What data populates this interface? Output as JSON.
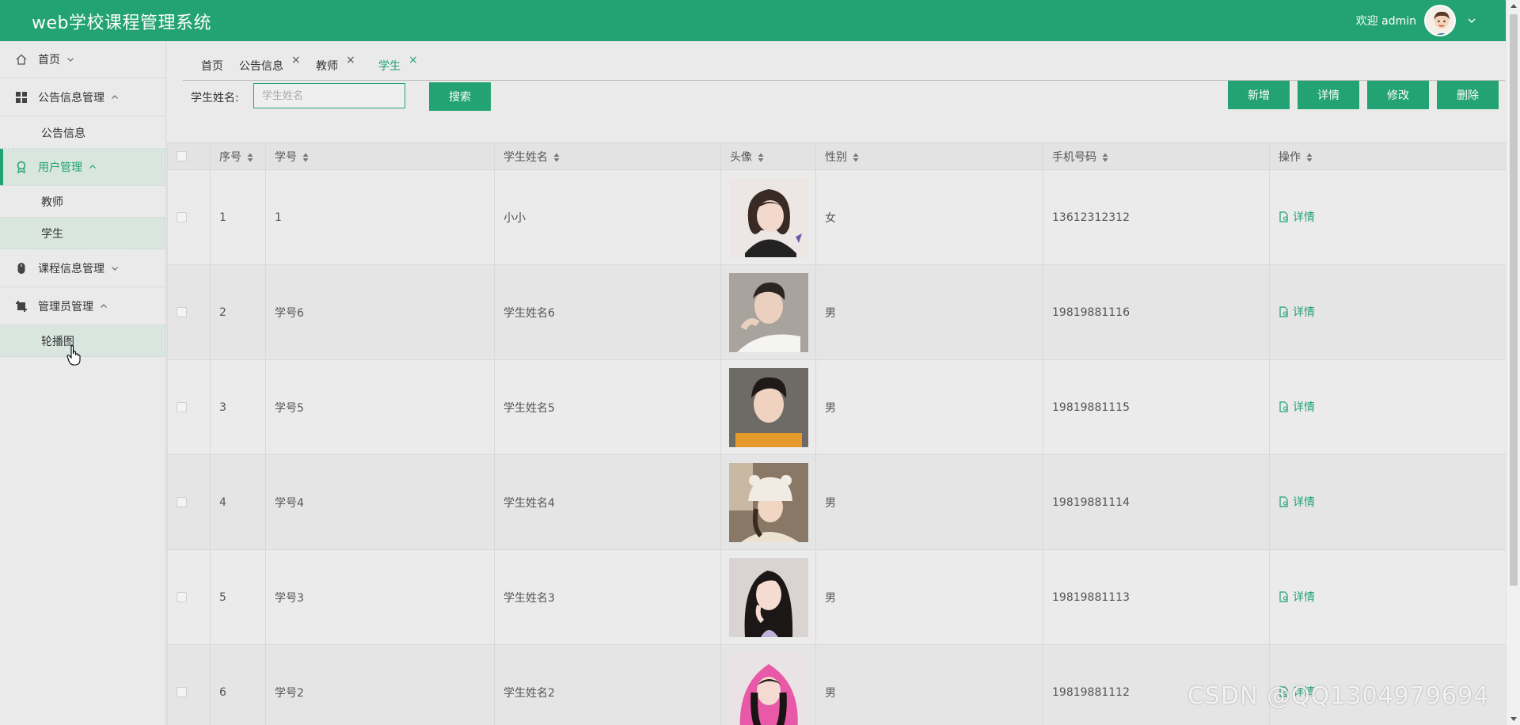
{
  "header": {
    "app_title": "web学校课程管理系统",
    "welcome": "欢迎 admin",
    "brand_color": "#23a274"
  },
  "sidebar": {
    "items": [
      {
        "label": "首页",
        "icon": "home-icon",
        "expanded": false
      },
      {
        "label": "公告信息管理",
        "icon": "grid-icon",
        "expanded": true,
        "children": [
          "公告信息"
        ]
      },
      {
        "label": "用户管理",
        "icon": "award-icon",
        "expanded": true,
        "active": true,
        "children": [
          "教师",
          "学生"
        ]
      },
      {
        "label": "课程信息管理",
        "icon": "mouse-icon",
        "expanded": false
      },
      {
        "label": "管理员管理",
        "icon": "crop-icon",
        "expanded": true,
        "children": [
          "轮播图"
        ]
      }
    ]
  },
  "tabs": [
    {
      "label": "首页",
      "closable": false
    },
    {
      "label": "公告信息",
      "closable": true
    },
    {
      "label": "教师",
      "closable": true
    },
    {
      "label": "学生",
      "closable": true,
      "current": true
    }
  ],
  "tab_close_glyph": "×",
  "search": {
    "label": "学生姓名:",
    "placeholder": "学生姓名",
    "value": "",
    "button": "搜索"
  },
  "actions": {
    "add": "新增",
    "detail": "详情",
    "edit": "修改",
    "delete": "删除"
  },
  "table": {
    "columns": [
      "序号",
      "学号",
      "学生姓名",
      "头像",
      "性别",
      "手机号码",
      "操作"
    ],
    "detail_label": "详情",
    "rows": [
      {
        "index": "1",
        "student_no": "1",
        "name": "小小",
        "photo": "avatar-girl-bob-hair",
        "gender": "女",
        "phone": "13612312312"
      },
      {
        "index": "2",
        "student_no": "学号6",
        "name": "学生姓名6",
        "photo": "avatar-boy-white-shirt",
        "gender": "男",
        "phone": "19819881116"
      },
      {
        "index": "3",
        "student_no": "学号5",
        "name": "学生姓名5",
        "photo": "avatar-boy-orange-shirt",
        "gender": "男",
        "phone": "19819881115"
      },
      {
        "index": "4",
        "student_no": "学号4",
        "name": "学生姓名4",
        "photo": "avatar-girl-bucket-hat",
        "gender": "男",
        "phone": "19819881114"
      },
      {
        "index": "5",
        "student_no": "学号3",
        "name": "学生姓名3",
        "photo": "avatar-girl-long-hair",
        "gender": "男",
        "phone": "19819881113"
      },
      {
        "index": "6",
        "student_no": "学号2",
        "name": "学生姓名2",
        "photo": "avatar-girl-pink-hoodie",
        "gender": "男",
        "phone": "19819881112"
      }
    ]
  },
  "watermark": "CSDN @QQ1304979694"
}
